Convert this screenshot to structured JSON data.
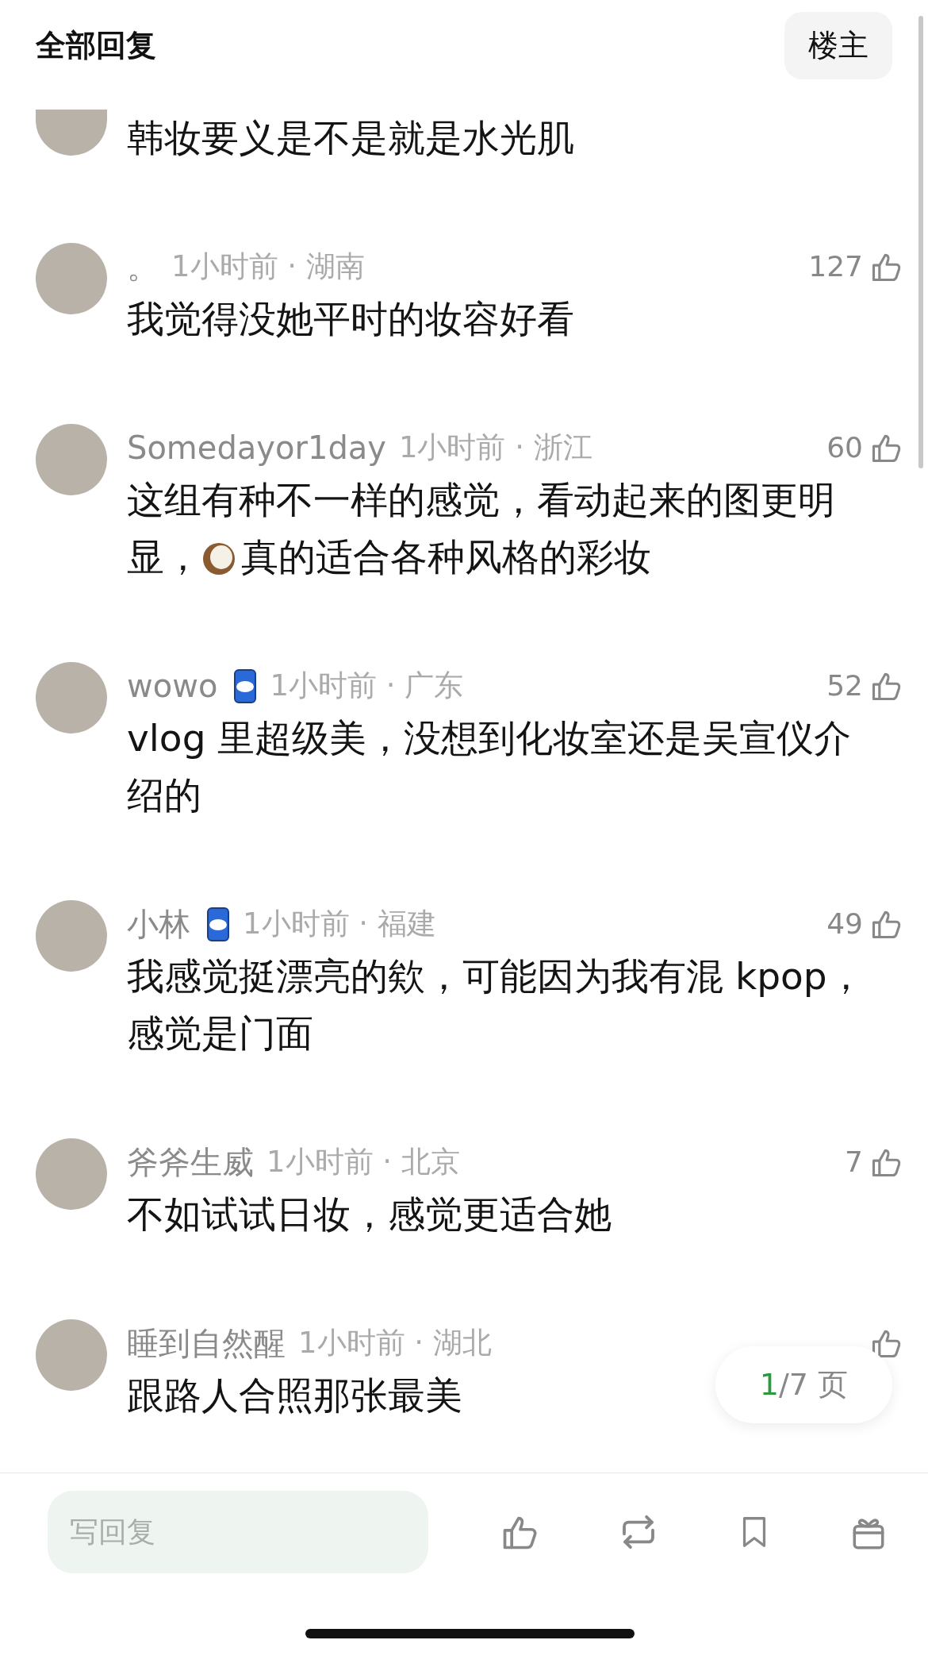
{
  "header": {
    "title": "全部回复",
    "op_button": "楼主"
  },
  "comments": [
    {
      "body": [
        {
          "kind": "text",
          "text": "韩妆要义是不是就是水光肌"
        }
      ]
    },
    {
      "user": "。",
      "badge": false,
      "time": "1小时前 · 湖南",
      "likes": "127",
      "body": [
        {
          "kind": "text",
          "text": "我觉得没她平时的妆容好看"
        }
      ]
    },
    {
      "user": "Somedayor1day",
      "badge": false,
      "time": "1小时前 · 浙江",
      "likes": "60",
      "body": [
        {
          "kind": "text",
          "text": "这组有种不一样的感觉，看动起来的图更明显，"
        },
        {
          "kind": "emoji"
        },
        {
          "kind": "text",
          "text": "真的适合各种风格的彩妆"
        }
      ]
    },
    {
      "user": "wowo",
      "badge": true,
      "time": "1小时前 · 广东",
      "likes": "52",
      "body": [
        {
          "kind": "text",
          "text": "vlog 里超级美，没想到化妆室还是吴宣仪介绍的"
        }
      ]
    },
    {
      "user": "小林",
      "badge": true,
      "time": "1小时前 · 福建",
      "likes": "49",
      "body": [
        {
          "kind": "text",
          "text": "我感觉挺漂亮的欸，可能因为我有混 kpop，感觉是门面"
        }
      ]
    },
    {
      "user": "斧斧生威",
      "badge": false,
      "time": "1小时前 · 北京",
      "likes": "7",
      "body": [
        {
          "kind": "text",
          "text": "不如试试日妆，感觉更适合她"
        }
      ]
    },
    {
      "user": "睡到自然醒",
      "badge": false,
      "time": "1小时前 · 湖北",
      "body": [
        {
          "kind": "text",
          "text": "跟路人合照那张最美"
        }
      ]
    }
  ],
  "pager": {
    "current": "1",
    "rest": "/7 页"
  },
  "reply_bar": {
    "placeholder": "写回复"
  }
}
